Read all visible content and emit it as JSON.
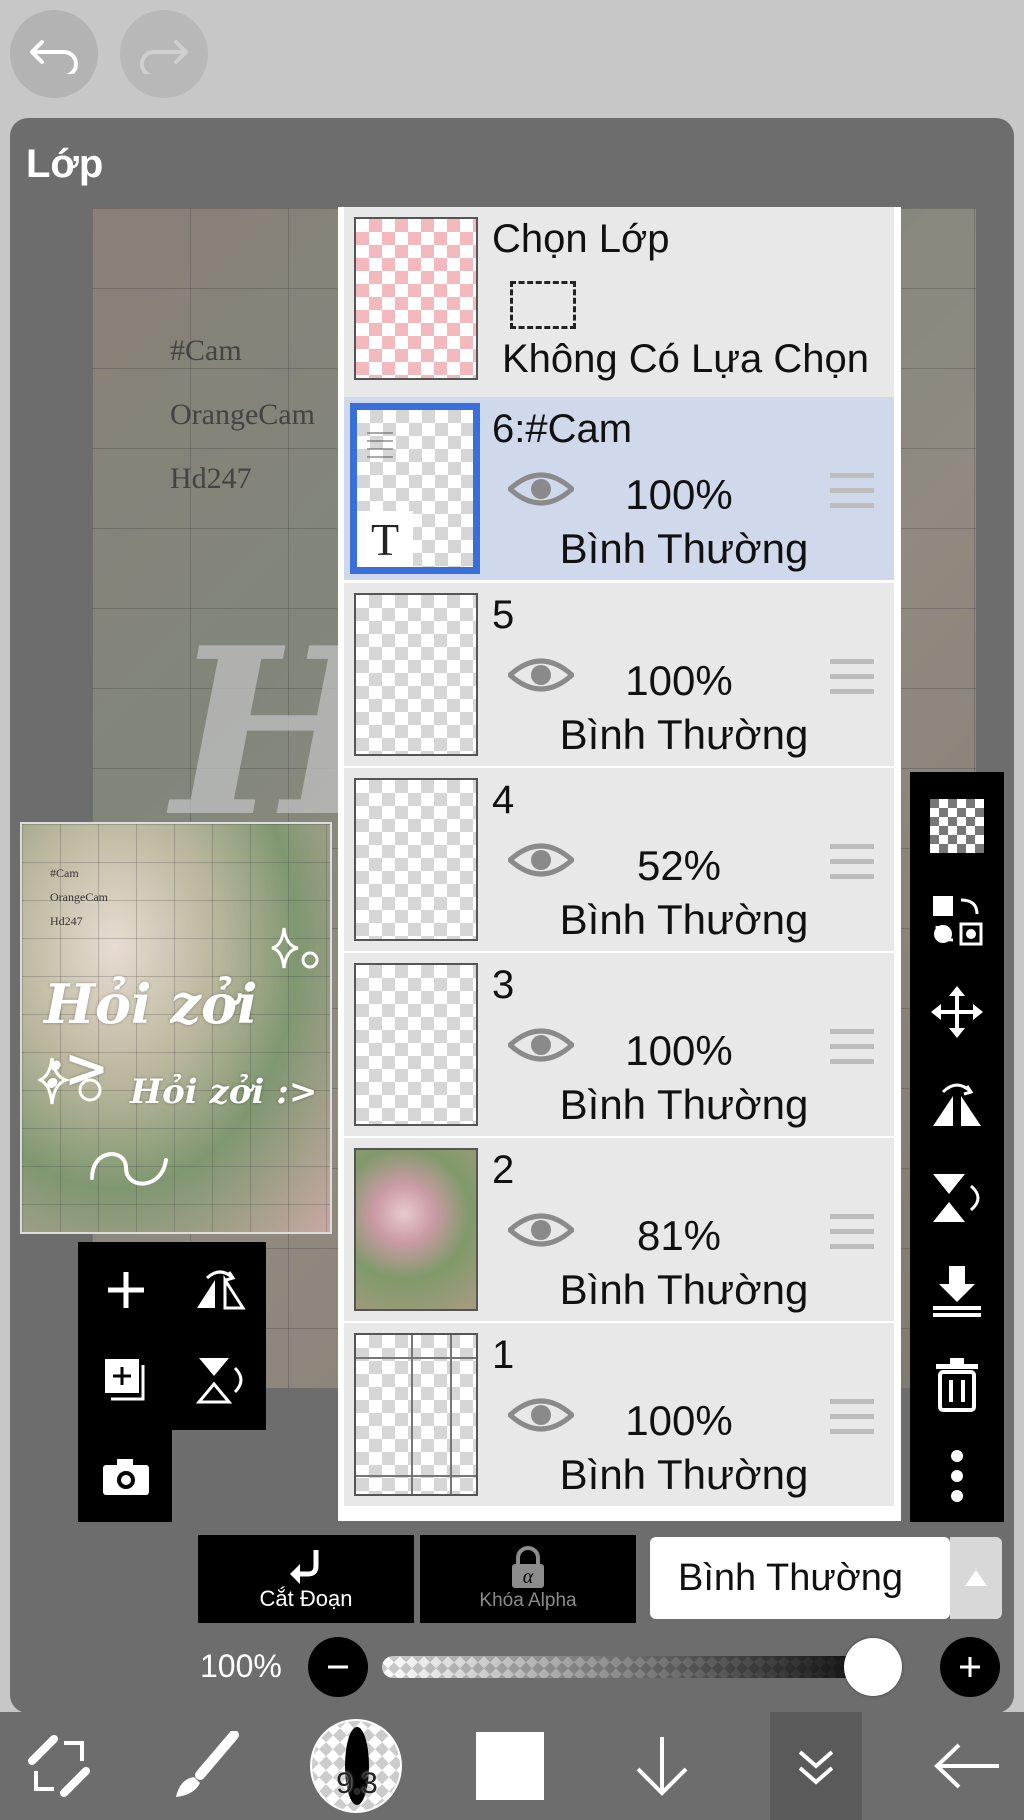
{
  "top": {
    "undo_icon": "undo-icon",
    "redo_icon": "redo-icon"
  },
  "panel": {
    "title": "Lớp"
  },
  "canvas": {
    "lines": [
      "#Cam",
      "OrangeCam",
      "Hd247"
    ],
    "overlay": "Hỏi"
  },
  "preview": {
    "lines": [
      "#Cam",
      "OrangeCam",
      "Hd247"
    ],
    "big1": "Hỏi zởi :>",
    "big2": "Hỏi zởi :>"
  },
  "selection_layer": {
    "name": "Chọn Lớp",
    "status": "Không Có Lựa Chọn"
  },
  "layers": [
    {
      "name": "6:#Cam",
      "opacity": "100%",
      "blend": "Bình Thường",
      "selected": true
    },
    {
      "name": "5",
      "opacity": "100%",
      "blend": "Bình Thường",
      "selected": false
    },
    {
      "name": "4",
      "opacity": "52%",
      "blend": "Bình Thường",
      "selected": false
    },
    {
      "name": "3",
      "opacity": "100%",
      "blend": "Bình Thường",
      "selected": false
    },
    {
      "name": "2",
      "opacity": "81%",
      "blend": "Bình Thường",
      "selected": false
    },
    {
      "name": "1",
      "opacity": "100%",
      "blend": "Bình Thường",
      "selected": false
    }
  ],
  "bottom": {
    "clip_label": "Cắt Đoạn",
    "alpha_label": "Khóa Alpha",
    "blend_mode": "Bình Thường"
  },
  "opacity": {
    "label": "100%",
    "value": 1.0
  },
  "toolbar": {
    "brush_size": "9.3"
  },
  "colors": {
    "accent": "#3a6fd8",
    "selected_row": "#d0d8ec"
  }
}
